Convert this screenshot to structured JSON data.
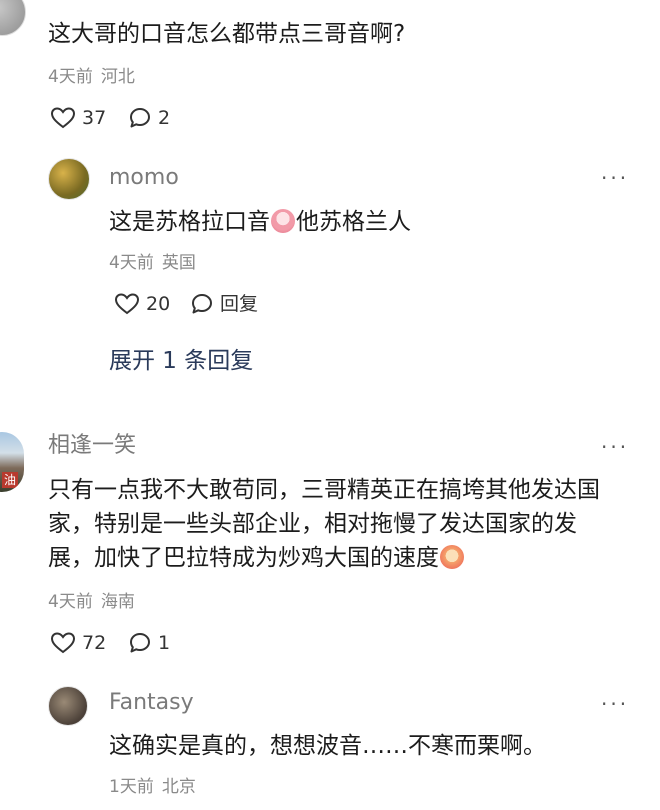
{
  "comments": [
    {
      "text": "这大哥的口音怎么都带点三哥音啊?",
      "time": "4天前",
      "location": "河北",
      "likes": "37",
      "replies": "2"
    },
    {
      "name": "momo",
      "text": "这是苏格拉口音",
      "text_after": "他苏格兰人",
      "time": "4天前",
      "location": "英国",
      "likes": "20",
      "reply_label": "回复",
      "more": "···"
    },
    {
      "expand_label": "展开 1 条回复"
    },
    {
      "name": "相逢一笑",
      "avatar_text": "油",
      "text_line1": "只有一点我不大敢苟同，三哥精英正在搞垮其他发达国",
      "text_line2": "家，特别是一些头部企业，相对拖慢了发达国家的发",
      "text_line3": "展，加快了巴拉特成为炒鸡大国的速度",
      "time": "4天前",
      "location": "海南",
      "likes": "72",
      "replies": "1",
      "more": "···"
    },
    {
      "name": "Fantasy",
      "text": "这确实是真的，想想波音……不寒而栗啊。",
      "time": "1天前",
      "location": "北京",
      "more": "···"
    }
  ],
  "colors": {
    "text": "#1c1c1c",
    "meta": "#8a8a8a",
    "name": "#7a7a7a",
    "expand": "#2a3a5a"
  },
  "icons": [
    "heart-icon",
    "comment-icon",
    "more-icon",
    "crying-emoji-icon",
    "surprised-emoji-icon"
  ]
}
